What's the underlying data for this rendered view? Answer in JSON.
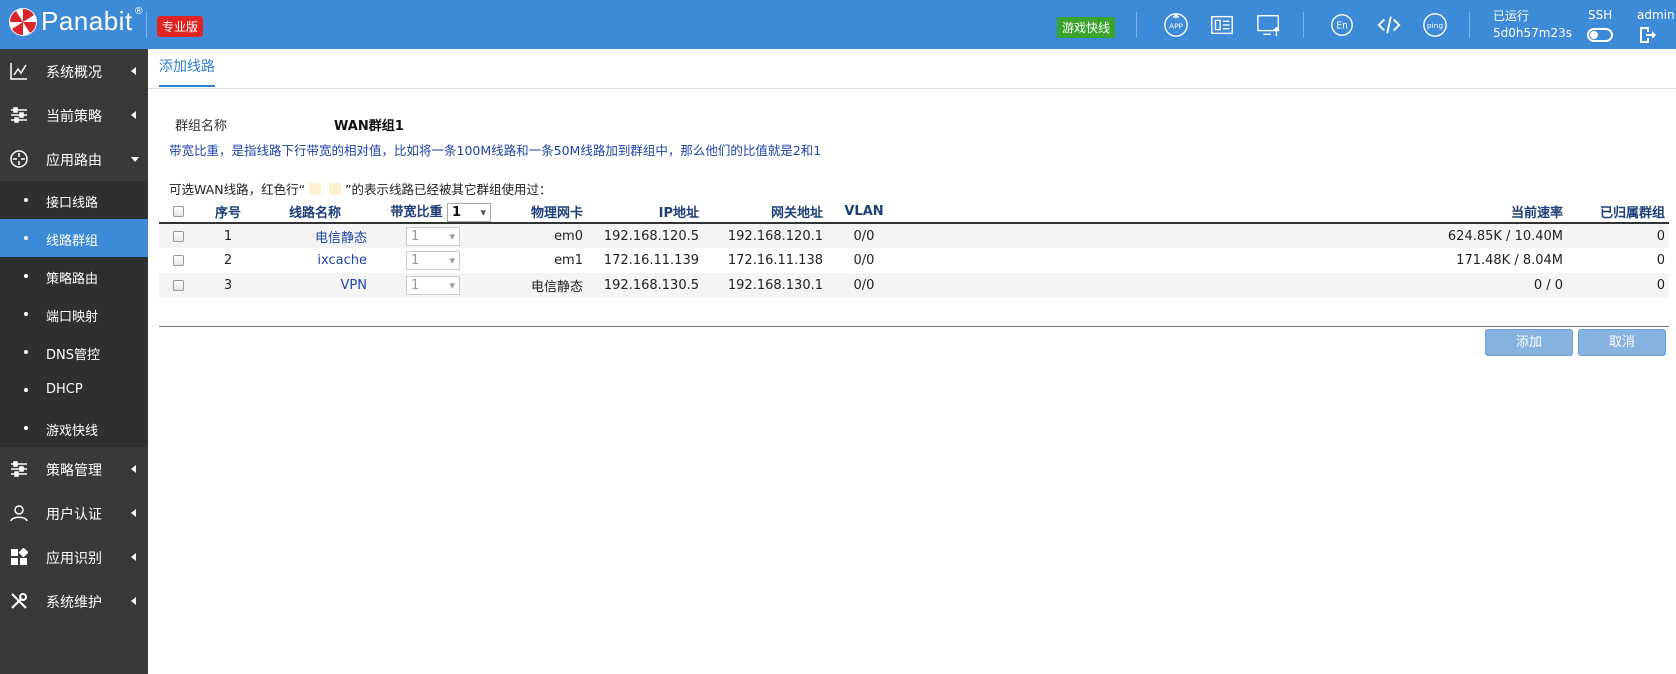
{
  "header": {
    "brand": "Panabit",
    "brand_mark": "®",
    "edition": "专业版",
    "game_accel": "游戏快线",
    "uptime_label": "已运行",
    "uptime_value": "5d0h57m23s",
    "ssh_label": "SSH",
    "user": "admin",
    "icons": [
      "app-icon",
      "monitor-panel-icon",
      "screen-upload-icon",
      "language-en-icon",
      "code-icon",
      "ping-icon",
      "logout-icon"
    ],
    "colors": {
      "bar": "#3c8ad8",
      "edition": "#e02424",
      "game": "#3aa52d"
    }
  },
  "sidebar": {
    "items": [
      {
        "label": "系统概况",
        "icon": "line-chart-icon"
      },
      {
        "label": "当前策略",
        "icon": "sliders-icon"
      },
      {
        "label": "应用路由",
        "icon": "router-icon",
        "expanded": true
      }
    ],
    "sub_items": [
      {
        "label": "接口线路"
      },
      {
        "label": "线路群组",
        "active": true
      },
      {
        "label": "策略路由"
      },
      {
        "label": "端口映射"
      },
      {
        "label": "DNS管控"
      },
      {
        "label": "DHCP"
      },
      {
        "label": "游戏快线"
      }
    ],
    "items_after": [
      {
        "label": "策略管理",
        "icon": "sliders-icon"
      },
      {
        "label": "用户认证",
        "icon": "user-icon"
      },
      {
        "label": "应用识别",
        "icon": "grid-icon"
      },
      {
        "label": "系统维护",
        "icon": "tools-icon"
      }
    ]
  },
  "main": {
    "tab": "添加线路",
    "group_name_label": "群组名称",
    "group_name_value": "WAN群组1",
    "hint_blue": "带宽比重，是指线路下行带宽的相对值，比如将一条100M线路和一条50M线路加到群组中，那么他们的比值就是2和1",
    "hint_prefix": "可选WAN线路，红色行“",
    "hint_suffix": "”的表示线路已经被其它群组使用过：",
    "table": {
      "headers": {
        "seq": "序号",
        "name": "线路名称",
        "weight": "带宽比重",
        "weight_select": "1",
        "nic": "物理网卡",
        "ip": "IP地址",
        "gw": "网关地址",
        "vlan": "VLAN",
        "rate": "当前速率",
        "group": "已归属群组"
      },
      "rows": [
        {
          "seq": "1",
          "name": "电信静态",
          "weight": "1",
          "nic": "em0",
          "ip": "192.168.120.5",
          "gw": "192.168.120.1",
          "vlan": "0/0",
          "rate": "624.85K / 10.40M",
          "group": "0"
        },
        {
          "seq": "2",
          "name": "ixcache",
          "weight": "1",
          "nic": "em1",
          "ip": "172.16.11.139",
          "gw": "172.16.11.138",
          "vlan": "0/0",
          "rate": "171.48K / 8.04M",
          "group": "0"
        },
        {
          "seq": "3",
          "name": "VPN",
          "weight": "1",
          "nic": "电信静态",
          "ip": "192.168.130.5",
          "gw": "192.168.130.1",
          "vlan": "0/0",
          "rate": "0 / 0",
          "group": "0"
        }
      ]
    },
    "buttons": {
      "add": "添加",
      "cancel": "取消"
    }
  }
}
